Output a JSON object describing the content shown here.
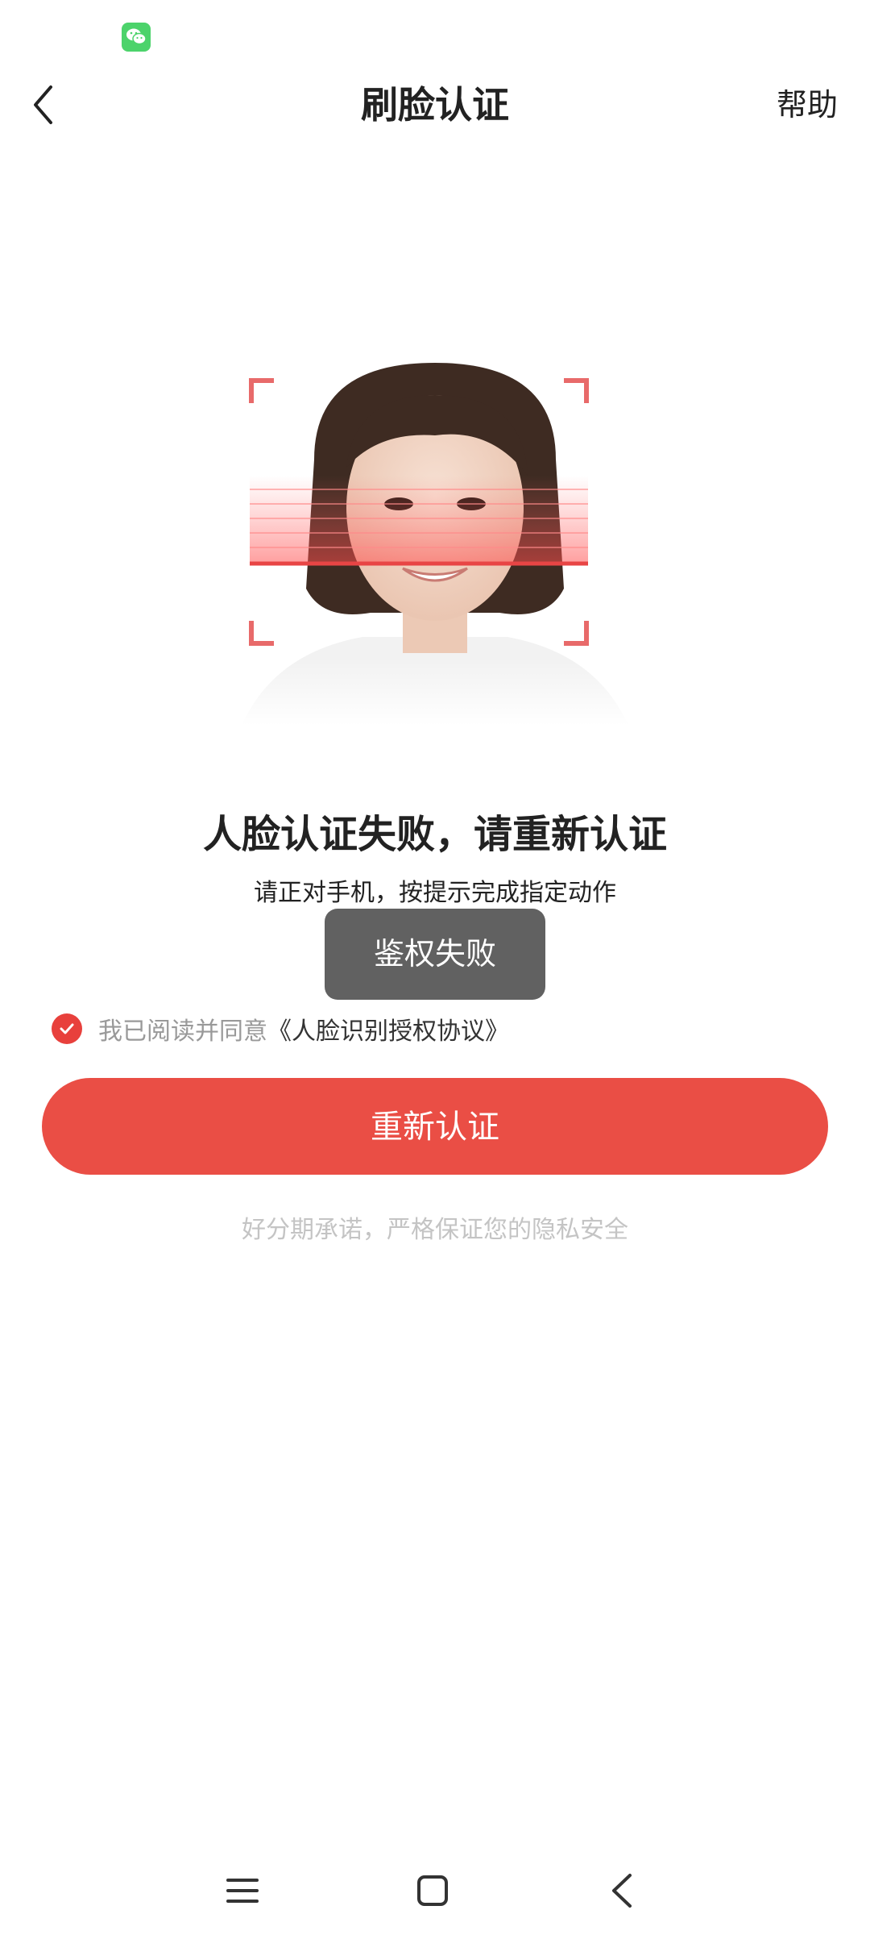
{
  "status_bar": {
    "notification_icon": "wechat-icon"
  },
  "nav": {
    "back_icon": "chevron-left-icon",
    "title": "刷脸认证",
    "help_label": "帮助"
  },
  "result": {
    "title": "人脸认证失败，请重新认证",
    "subtitle": "请正对手机，按提示完成指定动作"
  },
  "toast": {
    "text": "鉴权失败"
  },
  "agreement": {
    "checked": true,
    "prefix": "我已阅读并同意",
    "link": "《人脸识别授权协议》"
  },
  "retry_button": {
    "label": "重新认证"
  },
  "privacy_note": "好分期承诺，严格保证您的隐私安全",
  "system_nav": {
    "menu_icon": "menu-icon",
    "home_icon": "home-square-icon",
    "back_icon": "back-triangle-icon"
  },
  "colors": {
    "accent": "#ea4e45",
    "check": "#e8403c",
    "scan_corner": "#e86a6a"
  }
}
